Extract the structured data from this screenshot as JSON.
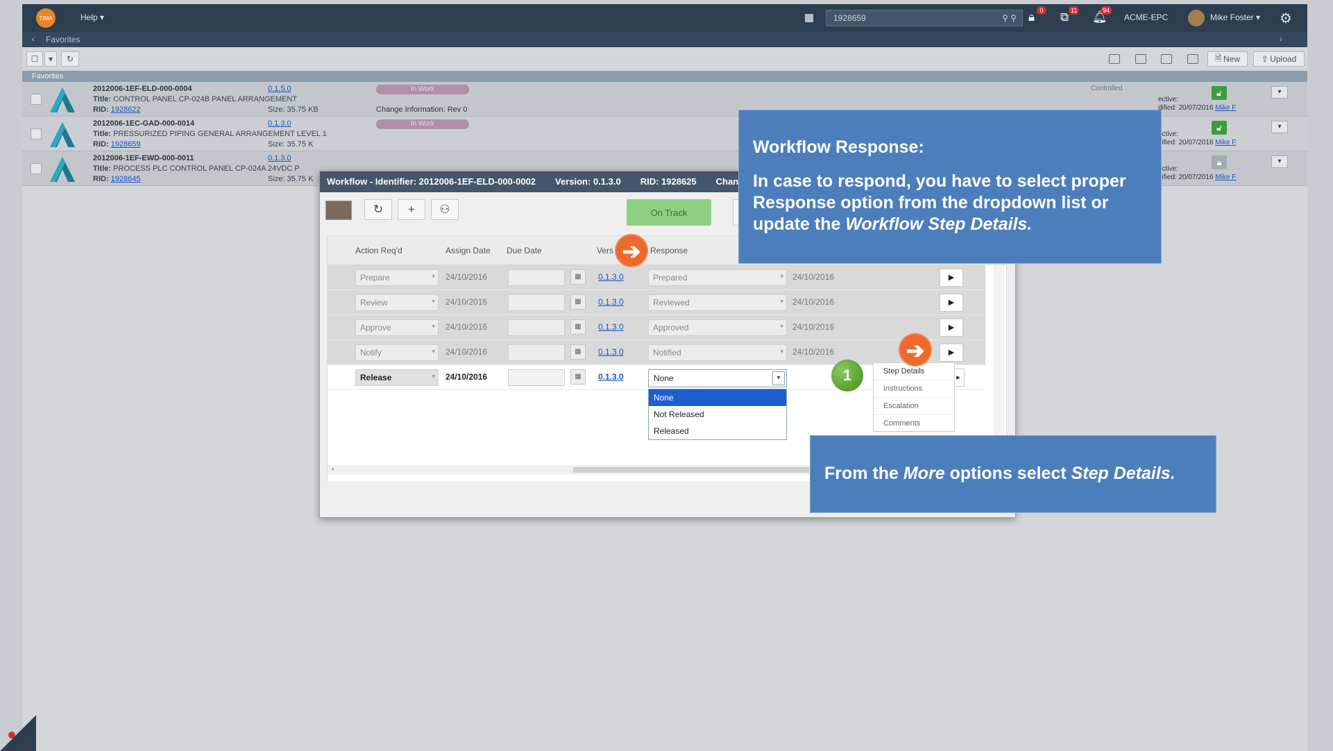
{
  "topbar": {
    "logo_text": "TIMA",
    "help_label": "Help ▾",
    "search_value": "1928659",
    "lock_badge": "0",
    "org_badge": "11",
    "bell_badge": "94",
    "company": "ACME-EPC",
    "user": "Mike Foster ▾"
  },
  "breadcrumb": {
    "label": "Favorites"
  },
  "toolbar": {
    "new_label": "New",
    "upload_label": "Upload"
  },
  "favorites": {
    "header": "Favorites",
    "rows": [
      {
        "id": "2012006-1EF-ELD-000-0004",
        "version": "0.1.5.0",
        "title_label": "Title:",
        "title": "CONTROL PANEL CP-024B PANEL ARRANGEMENT",
        "rid_label": "RID:",
        "rid": "1928622",
        "size": "Size: 35.75 KB",
        "status": "In Work",
        "change_info": "Change Information: Rev 0",
        "controlled": "Controlled",
        "effective": "ective:",
        "modified": "dified: 20/07/2016",
        "modified_by": "Mike F"
      },
      {
        "id": "2012006-1EC-GAD-000-0014",
        "version": "0.1.3.0",
        "title_label": "Title:",
        "title": "PRESSURIZED PIPING GENERAL ARRANGEMENT LEVEL 1",
        "rid_label": "RID:",
        "rid": "1928659",
        "size": "Size: 35.75 K",
        "status": "In Work",
        "change_info": "",
        "controlled": "",
        "effective": "ective:",
        "modified": "dified: 20/07/2016",
        "modified_by": "Mike F"
      },
      {
        "id": "2012006-1EF-EWD-000-0011",
        "version": "0.1.3.0",
        "title_label": "Title:",
        "title": "PROCESS PLC CONTROL PANEL CP-024A 24VDC P",
        "rid_label": "RID:",
        "rid": "1928645",
        "size": "Size: 35.75 K",
        "status": "",
        "change_info": "",
        "controlled": "",
        "effective": "ective:",
        "modified": "dified: 20/07/2016",
        "modified_by": "Mike F"
      }
    ]
  },
  "dialog": {
    "title_identifier": "Workflow - Identifier: 2012006-1EF-ELD-000-0002",
    "title_version": "Version: 0.1.3.0",
    "title_rid": "RID: 1928625",
    "title_change": "Change",
    "on_track": "On Track",
    "columns": {
      "action": "Action Req'd",
      "assign": "Assign Date",
      "due": "Due Date",
      "version": "Vers",
      "response": "Response"
    },
    "steps": [
      {
        "action": "Prepare",
        "assign": "24/10/2016",
        "version": "0.1.3.0",
        "response": "Prepared",
        "date": "24/10/2016"
      },
      {
        "action": "Review",
        "assign": "24/10/2016",
        "version": "0.1.3.0",
        "response": "Reviewed",
        "date": "24/10/2016"
      },
      {
        "action": "Approve",
        "assign": "24/10/2016",
        "version": "0.1.3.0",
        "response": "Approved",
        "date": "24/10/2016"
      },
      {
        "action": "Notify",
        "assign": "24/10/2016",
        "version": "0.1.3.0",
        "response": "Notified",
        "date": "24/10/2016"
      },
      {
        "action": "Release",
        "assign": "24/10/2016",
        "version": "0.1.3.0",
        "response": "None"
      }
    ],
    "response_options": [
      "None",
      "Not Released",
      "Released"
    ],
    "more_menu": [
      "Step Details",
      "Instructions",
      "Escalation",
      "Comments"
    ]
  },
  "callouts": {
    "c1_heading": "Workflow Response:",
    "c1_body_a": "In case to respond, you have to select proper Response option from the dropdown list or update the ",
    "c1_body_em": "Workflow Step Details.",
    "c2_a": "From the ",
    "c2_em1": "More",
    "c2_b": " options select ",
    "c2_em2": "Step Details."
  },
  "step_marker": "1",
  "colors": {
    "topbar": "#2c3e50",
    "callout": "#4d7ebc",
    "arrow": "#ed6a2c",
    "on_track": "#8ed081",
    "selected_option": "#1c5fd1"
  }
}
